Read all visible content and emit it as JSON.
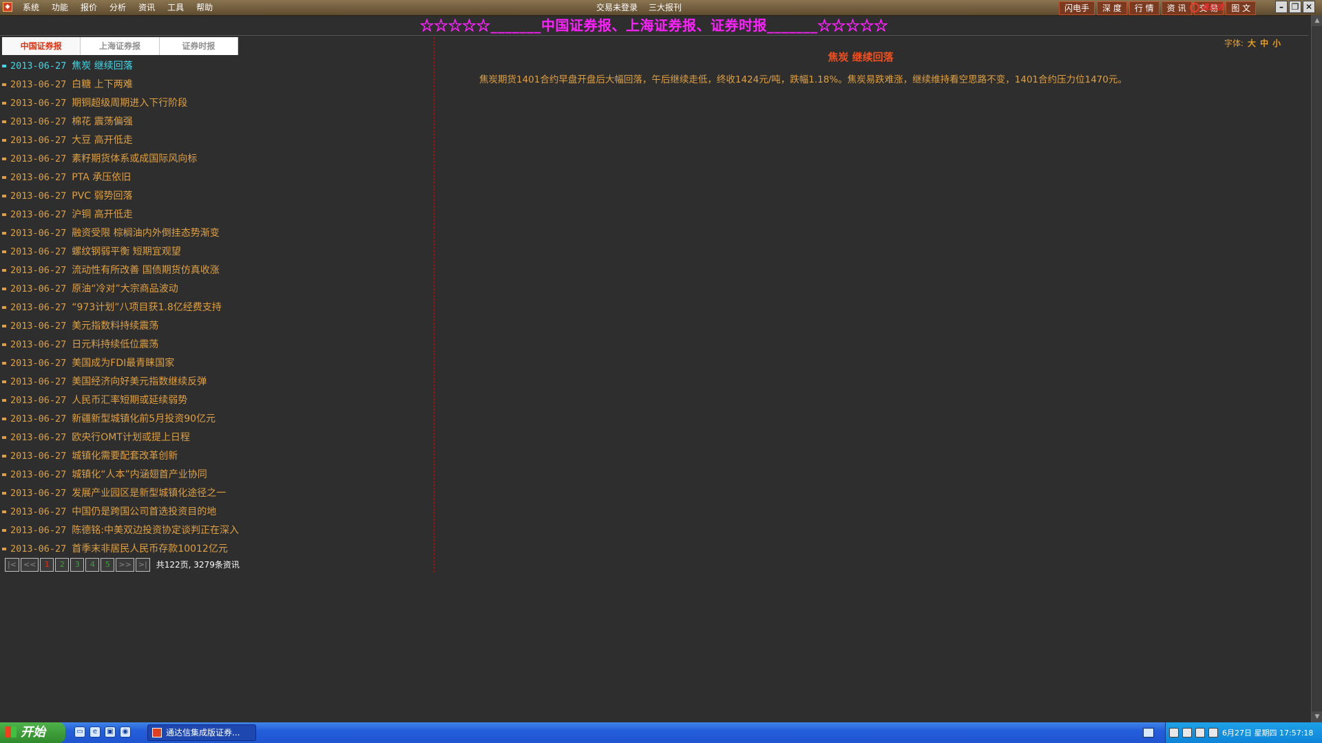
{
  "app": {
    "menu": [
      "系统",
      "功能",
      "报价",
      "分析",
      "资讯",
      "工具",
      "帮助"
    ],
    "status_left": "交易未登录",
    "status_right": "三大报刊",
    "right_buttons": [
      "闪电手",
      "深 度",
      "行 情",
      "资 讯",
      "交 易",
      "图 文"
    ],
    "brand": "通达信"
  },
  "banner": "☆☆☆☆☆_______中国证券报、上海证券报、证券时报_______☆☆☆☆☆",
  "tabs": [
    {
      "label": "中国证券报",
      "active": true
    },
    {
      "label": "上海证券报",
      "active": false
    },
    {
      "label": "证券时报",
      "active": false
    }
  ],
  "news": [
    {
      "date": "2013-06-27",
      "title": "焦炭 继续回落"
    },
    {
      "date": "2013-06-27",
      "title": "白糖 上下两难"
    },
    {
      "date": "2013-06-27",
      "title": "期铜超级周期进入下行阶段"
    },
    {
      "date": "2013-06-27",
      "title": "棉花 震荡偏强"
    },
    {
      "date": "2013-06-27",
      "title": "大豆 高开低走"
    },
    {
      "date": "2013-06-27",
      "title": "素籽期货体系或成国际风向标"
    },
    {
      "date": "2013-06-27",
      "title": "PTA 承压依旧"
    },
    {
      "date": "2013-06-27",
      "title": "PVC 弱势回落"
    },
    {
      "date": "2013-06-27",
      "title": "沪铜 高开低走"
    },
    {
      "date": "2013-06-27",
      "title": "融资受限 棕榈油内外倒挂态势渐变"
    },
    {
      "date": "2013-06-27",
      "title": "螺纹钢弱平衡 短期宜观望"
    },
    {
      "date": "2013-06-27",
      "title": "流动性有所改善 国债期货仿真收涨"
    },
    {
      "date": "2013-06-27",
      "title": "原油“冷对”大宗商品波动"
    },
    {
      "date": "2013-06-27",
      "title": "“973计划”八项目获1.8亿经费支持"
    },
    {
      "date": "2013-06-27",
      "title": "美元指数料持续震荡"
    },
    {
      "date": "2013-06-27",
      "title": "日元料持续低位震荡"
    },
    {
      "date": "2013-06-27",
      "title": "美国成为FDI最青睐国家"
    },
    {
      "date": "2013-06-27",
      "title": "美国经济向好美元指数继续反弹"
    },
    {
      "date": "2013-06-27",
      "title": "人民币汇率短期或延续弱势"
    },
    {
      "date": "2013-06-27",
      "title": "新疆新型城镇化前5月投资90亿元"
    },
    {
      "date": "2013-06-27",
      "title": "欧央行OMT计划或提上日程"
    },
    {
      "date": "2013-06-27",
      "title": "城镇化需要配套改革创新"
    },
    {
      "date": "2013-06-27",
      "title": "城镇化“人本”内涵翅首产业协同"
    },
    {
      "date": "2013-06-27",
      "title": "发展产业园区是新型城镇化途径之一"
    },
    {
      "date": "2013-06-27",
      "title": "中国仍是跨国公司首选投资目的地"
    },
    {
      "date": "2013-06-27",
      "title": "陈德铭:中美双边投资协定谈判正在深入"
    },
    {
      "date": "2013-06-27",
      "title": "首季末非居民人民币存款10012亿元"
    }
  ],
  "selected_index": 0,
  "pager": {
    "first": "|<",
    "prev": "<<",
    "pages": [
      "1",
      "2",
      "3",
      "4",
      "5"
    ],
    "current": "1",
    "next": ">>",
    "last": ">|",
    "info": "共122页, 3279条资讯"
  },
  "font_size": {
    "label": "字体:",
    "options": [
      "大",
      "中",
      "小"
    ]
  },
  "article": {
    "title": "焦炭 继续回落",
    "body": "焦炭期货1401合约早盘开盘后大幅回落，午后继续走低，终收1424元/吨，跌幅1.18%。焦炭易跌难涨，继续维持看空思路不变，1401合约压力位1470元。"
  },
  "taskbar": {
    "start_label": "开始",
    "task_label": "通达信集成版证券...",
    "clock": "6月27日 星期四 17:57:18"
  },
  "colors": {
    "background": "#2e2e2e",
    "accent_text": "#e0a040",
    "selected_text": "#40d8e8",
    "banner_text": "#ff20ff",
    "article_title": "#f05020"
  }
}
